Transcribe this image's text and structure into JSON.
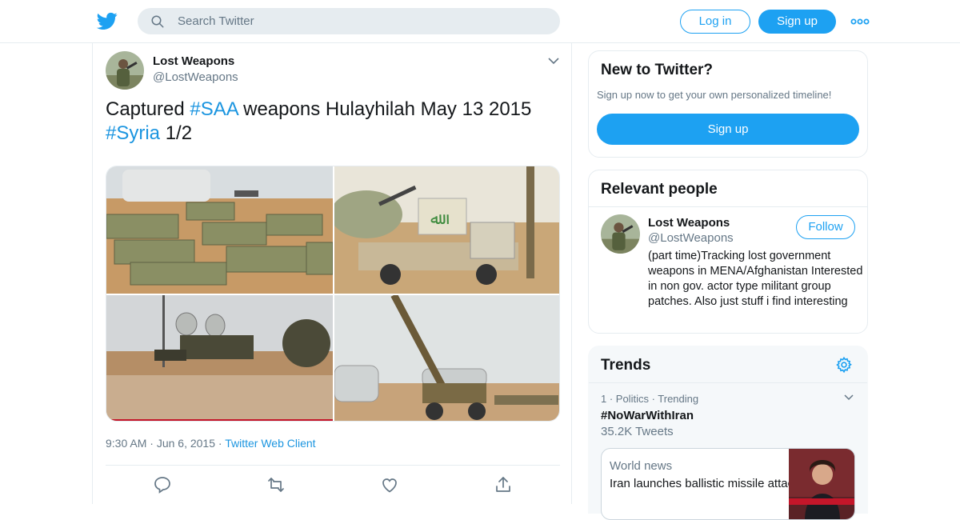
{
  "colors": {
    "accent": "#1da1f2",
    "link": "#1b95e0",
    "muted": "#657786",
    "border": "#e6ecf0"
  },
  "header": {
    "logo_icon": "twitter-bird-icon",
    "search_placeholder": "Search Twitter",
    "login_label": "Log in",
    "signup_label": "Sign up",
    "more_icon": "more-dots-icon"
  },
  "tweet": {
    "author_name": "Lost Weapons",
    "author_handle": "@LostWeapons",
    "text_part1": "Captured ",
    "hashtag1": "#SAA",
    "text_part2": " weapons Hulayhilah May 13 2015",
    "hashtag2": "#Syria",
    "text_part3": " 1/2",
    "time": "9:30 AM",
    "date": "Jun 6, 2015",
    "source": "Twitter Web Client",
    "photos": [
      "ammo-crates-photo",
      "truck-mounted-gun-photo",
      "radar-dishes-photo",
      "artillery-gun-photo"
    ],
    "actions": [
      "reply-icon",
      "retweet-icon",
      "like-icon",
      "share-icon"
    ]
  },
  "sidebar": {
    "new_title": "New to Twitter?",
    "new_subtitle": "Sign up now to get your own personalized timeline!",
    "new_button": "Sign up",
    "people_title": "Relevant people",
    "person": {
      "name": "Lost Weapons",
      "handle": "@LostWeapons",
      "follow_label": "Follow",
      "bio": "(part time)Tracking lost government weapons in MENA/Afghanistan Interested in non gov. actor type militant group patches. Also just stuff i find interesting"
    },
    "trends_title": "Trends",
    "trend": {
      "meta": "1 · Politics · Trending",
      "name": "#NoWarWithIran",
      "count": "35.2K Tweets"
    },
    "news": {
      "label": "World news",
      "title": "Iran launches ballistic missile attack on Iraqi airbases wher..."
    }
  }
}
